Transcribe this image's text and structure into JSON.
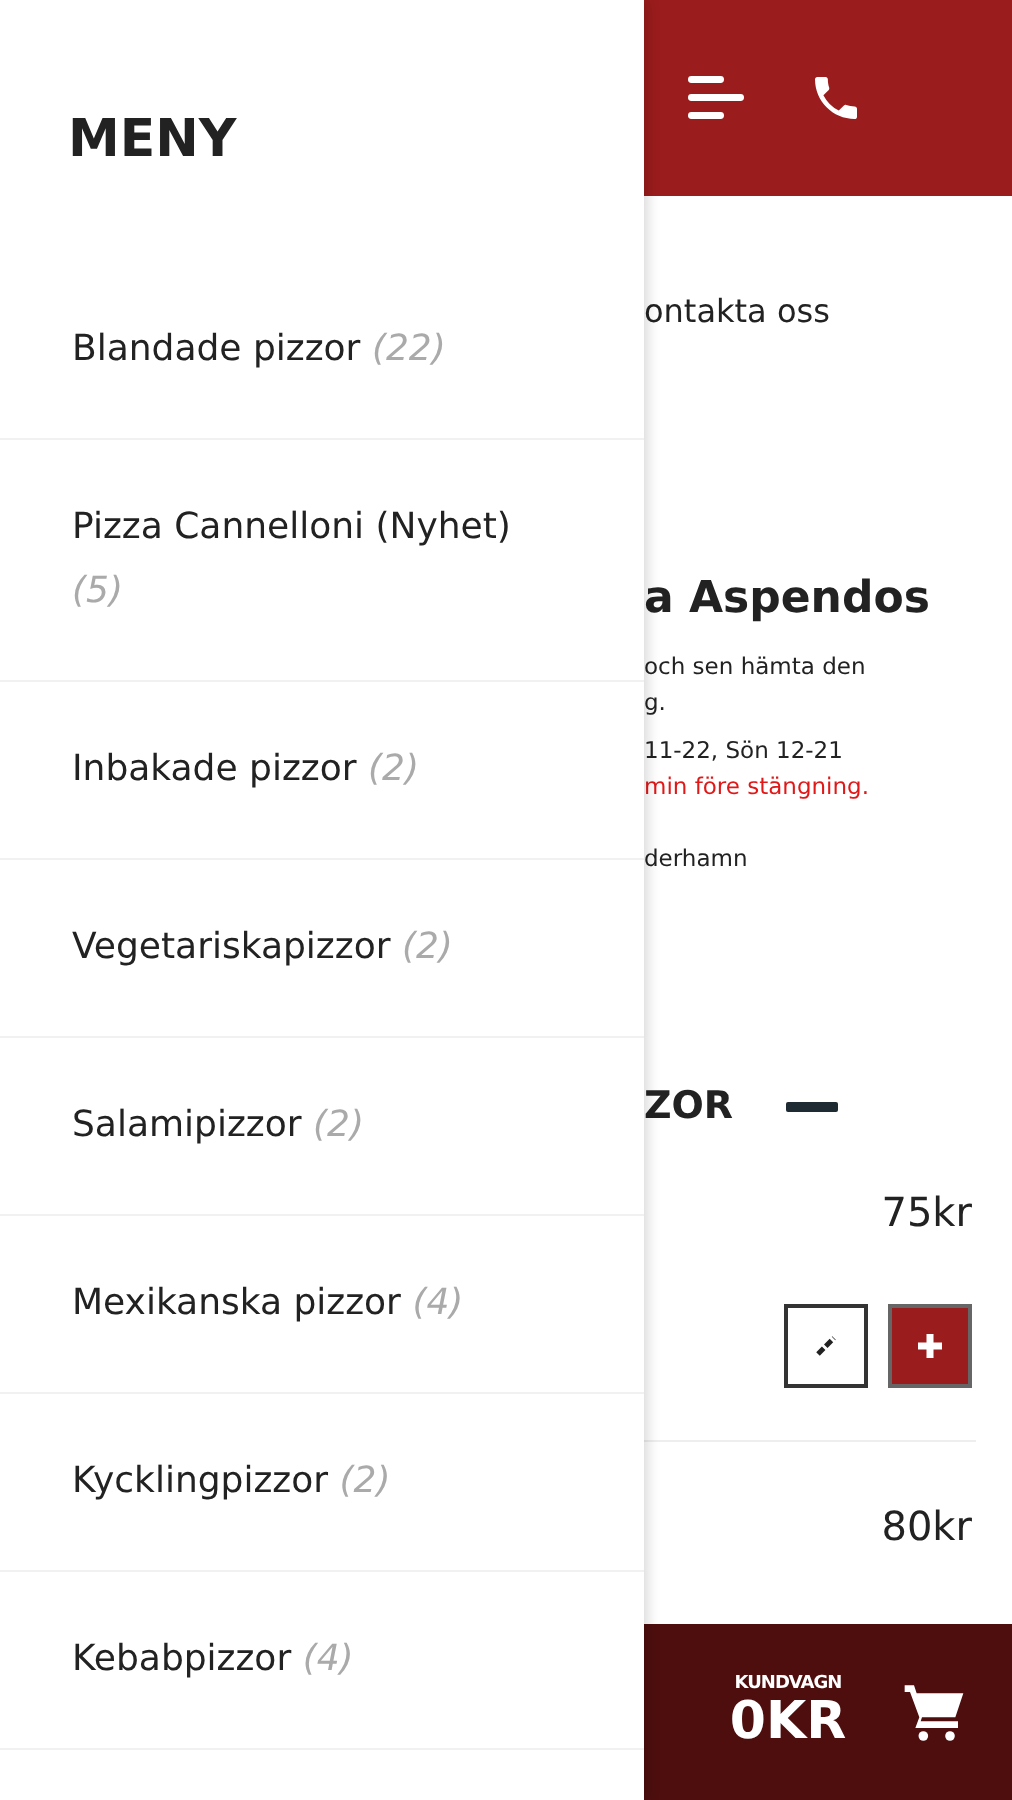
{
  "page": {
    "contact_text": "ontakta oss",
    "title": "a Aspendos",
    "info_lines": [
      {
        "text": "och sen hämta den",
        "kind": "normal"
      },
      {
        "text": "g.",
        "kind": "normal"
      },
      {
        "text": "11-22, Sön 12-21",
        "kind": "normal"
      },
      {
        "text": " min före stängning.",
        "kind": "warning"
      },
      {
        "text": "derhamn",
        "kind": "normal"
      }
    ],
    "section_title": "ZOR",
    "products": [
      {
        "price": "75kr",
        "show_actions": true
      },
      {
        "price": "80kr",
        "show_actions": false
      }
    ]
  },
  "cart": {
    "label": "KUNDVAGN",
    "total": "0KR"
  },
  "drawer": {
    "title": "MENY",
    "items": [
      {
        "name": "Blandade pizzor",
        "count": "(22)"
      },
      {
        "name": "Pizza Cannelloni (Nyhet)",
        "count": "(5)"
      },
      {
        "name": "Inbakade pizzor",
        "count": "(2)"
      },
      {
        "name": "Vegetariskapizzor",
        "count": "(2)"
      },
      {
        "name": "Salamipizzor",
        "count": "(2)"
      },
      {
        "name": "Mexikanska pizzor",
        "count": "(4)"
      },
      {
        "name": "Kycklingpizzor",
        "count": "(2)"
      },
      {
        "name": "Kebabpizzor",
        "count": "(4)"
      }
    ]
  }
}
